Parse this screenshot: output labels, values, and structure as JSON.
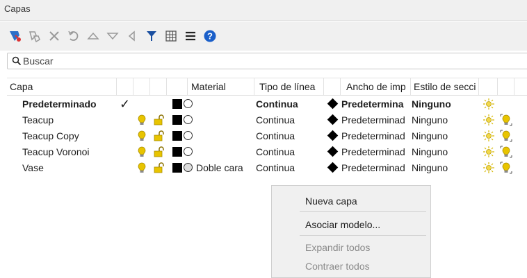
{
  "panel": {
    "title": "Capas"
  },
  "toolbar": {
    "buttons": [
      {
        "name": "new-layer-icon"
      },
      {
        "name": "new-sublayer-icon"
      },
      {
        "name": "delete-icon"
      },
      {
        "name": "undo-icon"
      },
      {
        "name": "move-up-icon"
      },
      {
        "name": "move-down-icon"
      },
      {
        "name": "move-left-icon"
      },
      {
        "name": "filter-icon",
        "color": "#1a4fa0"
      },
      {
        "name": "table-icon"
      },
      {
        "name": "menu-icon"
      },
      {
        "name": "help-icon",
        "color": "#1a5fc9"
      }
    ]
  },
  "search": {
    "placeholder": "Buscar"
  },
  "table": {
    "headers": {
      "capa": "Capa",
      "material": "Material",
      "tipo_linea": "Tipo de línea",
      "ancho": "Ancho de imp",
      "estilo": "Estilo de secci"
    },
    "rows": [
      {
        "name": "Predeterminado",
        "current": true,
        "material": "",
        "linetype": "Continua",
        "width": "Predetermina",
        "section": "Ninguno",
        "bold": true
      },
      {
        "name": "Teacup",
        "current": false,
        "material": "",
        "linetype": "Continua",
        "width": "Predeterminad",
        "section": "Ninguno"
      },
      {
        "name": "Teacup Copy",
        "current": false,
        "material": "",
        "linetype": "Continua",
        "width": "Predeterminad",
        "section": "Ninguno"
      },
      {
        "name": "Teacup Voronoi",
        "current": false,
        "material": "",
        "linetype": "Continua",
        "width": "Predeterminad",
        "section": "Ninguno"
      },
      {
        "name": "Vase",
        "current": false,
        "material": "Doble cara",
        "linetype": "Continua",
        "width": "Predeterminad",
        "section": "Ninguno"
      }
    ]
  },
  "context_menu": {
    "items": [
      {
        "label": "Nueva capa",
        "enabled": true
      },
      {
        "label": "Asociar modelo...",
        "enabled": true
      },
      {
        "label": "Expandir todos",
        "enabled": false
      },
      {
        "label": "Contraer todos",
        "enabled": false
      }
    ]
  },
  "colors": {
    "bulb": "#e8c400",
    "lock": "#e8c400",
    "accent": "#1a5fc9"
  }
}
